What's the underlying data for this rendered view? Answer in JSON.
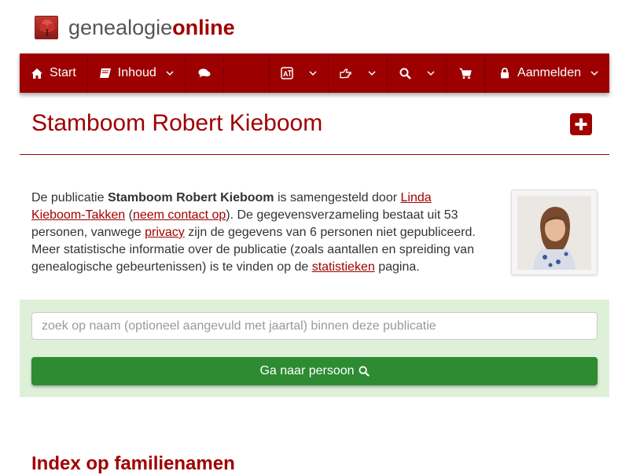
{
  "brand": {
    "part1": "genealogie",
    "part2": "online"
  },
  "nav": {
    "start": "Start",
    "inhoud": "Inhoud",
    "login": "Aanmelden"
  },
  "page": {
    "title": "Stamboom Robert Kieboom"
  },
  "intro": {
    "t1": "De publicatie ",
    "pub_name": "Stamboom Robert Kieboom",
    "t2": " is samengesteld door ",
    "author_link": "Linda Kieboom-Takken",
    "t3": " (",
    "contact_link": "neem contact op",
    "t4": "). De gegevensverzameling bestaat uit 53 personen, vanwege ",
    "privacy_link": "privacy",
    "t5": " zijn de gegevens van 6 personen niet gepubliceerd. Meer statistische informatie over de publicatie (zoals aantallen en spreiding van genealogische gebeurtenissen) is te vinden op de ",
    "stats_link": "statistieken",
    "t6": " pagina."
  },
  "search": {
    "placeholder": "zoek op naam (optioneel aangevuld met jaartal) binnen deze publicatie",
    "button_label": "Ga naar persoon"
  },
  "index": {
    "title": "Index op familienamen"
  },
  "colors": {
    "brand_red": "#9c0000",
    "panel_green": "#dff0d8",
    "button_green": "#2e8b32"
  }
}
